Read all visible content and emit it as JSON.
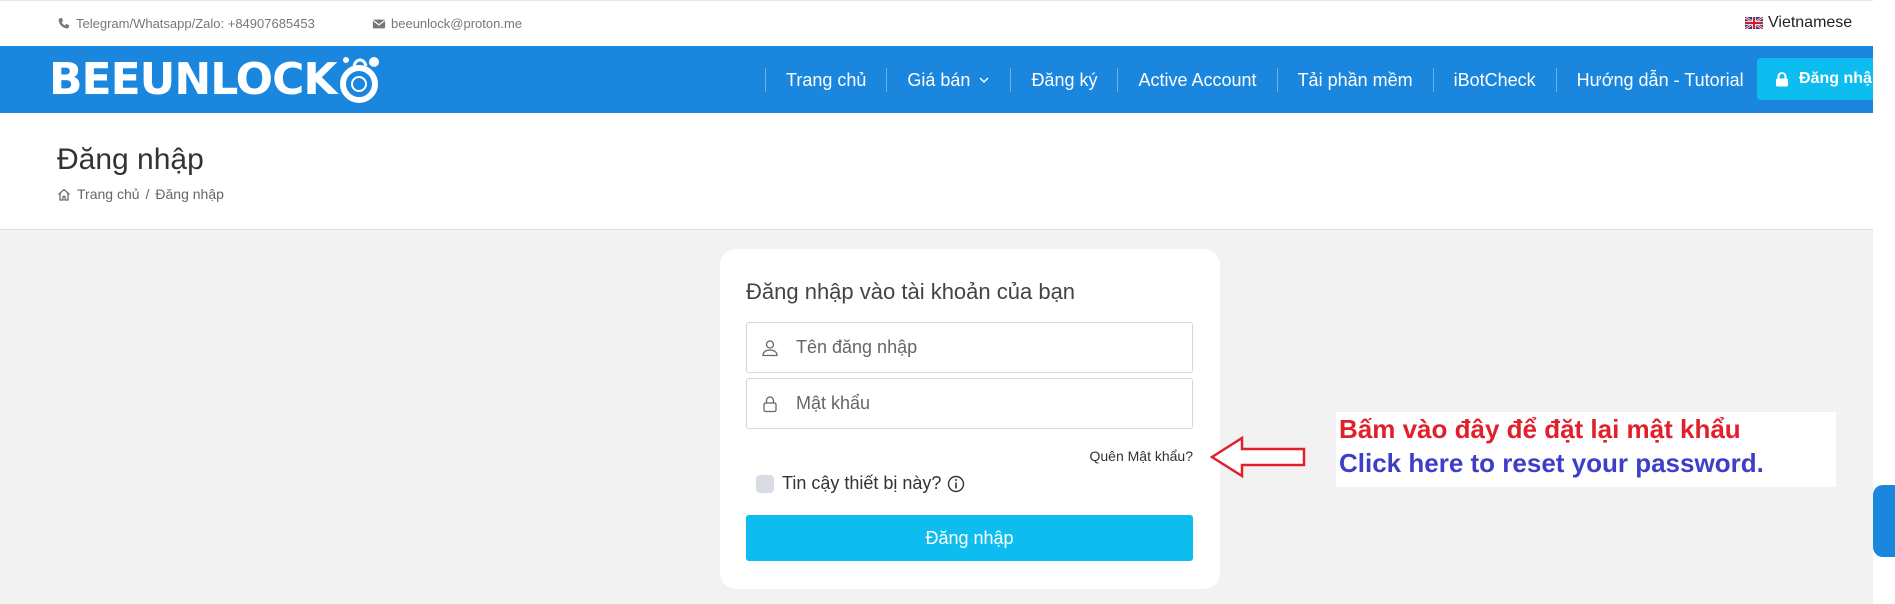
{
  "topbar": {
    "phone": "Telegram/Whatsapp/Zalo: +84907685453",
    "email": "beeunlock@proton.me",
    "language": "Vietnamese"
  },
  "brand": {
    "logo_text": "BEEUNLOCK"
  },
  "nav": {
    "items": [
      {
        "label": "Trang chủ"
      },
      {
        "label": "Giá bán"
      },
      {
        "label": "Đăng ký"
      },
      {
        "label": "Active Account"
      },
      {
        "label": "Tải phần mềm"
      },
      {
        "label": "iBotCheck"
      },
      {
        "label": "Hướng dẫn - Tutorial"
      }
    ],
    "login_label": "Đăng nhập"
  },
  "header": {
    "title": "Đăng nhập",
    "breadcrumb_home": "Trang chủ",
    "breadcrumb_sep": "/",
    "breadcrumb_current": "Đăng nhập"
  },
  "login_form": {
    "title": "Đăng nhập vào tài khoản của bạn",
    "username_placeholder": "Tên đăng nhập",
    "password_placeholder": "Mật khẩu",
    "forgot_label": "Quên Mật khẩu?",
    "trust_label": "Tin cậy thiết bị này?",
    "submit_label": "Đăng nhập"
  },
  "annotation": {
    "vi": "Bấm vào đây để đặt lại mật khẩu",
    "en": "Click here to reset your password."
  },
  "colors": {
    "brand_blue": "#1a86dd",
    "button_cyan": "#0ebdf0",
    "annotation_red": "#e0212b",
    "annotation_blue": "#3e3ec8"
  },
  "icons": [
    "phone-icon",
    "envelope-icon",
    "uk-flag-icon",
    "chevron-down-icon",
    "lock-icon",
    "home-icon",
    "user-icon",
    "info-icon",
    "arrow-left-icon"
  ]
}
